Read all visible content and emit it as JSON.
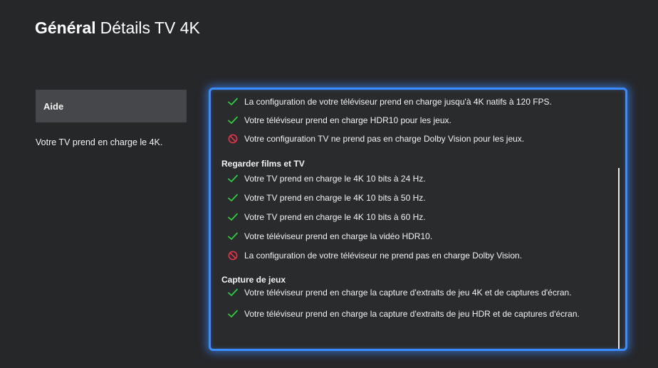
{
  "header": {
    "section": "Général",
    "subtitle": "Détails TV 4K"
  },
  "sidebar": {
    "button_label": "Aide",
    "description": "Votre TV prend en charge le 4K."
  },
  "colors": {
    "accent": "#3d8cff",
    "check": "#2ecc40",
    "unsupported": "#e8334a"
  },
  "details": {
    "rows_top": [
      {
        "status": "check",
        "text": "La configuration de votre téléviseur prend en charge jusqu'à 4K natifs à 120 FPS."
      },
      {
        "status": "check",
        "text": "Votre téléviseur prend en charge HDR10 pour les jeux."
      },
      {
        "status": "unsupported",
        "text": "Votre configuration TV ne prend pas en charge Dolby Vision pour les jeux."
      }
    ],
    "sections": [
      {
        "title": "Regarder films et TV",
        "rows": [
          {
            "status": "check",
            "text": "Votre TV prend en charge le 4K 10 bits à 24 Hz."
          },
          {
            "status": "check",
            "text": "Votre TV prend en charge le 4K 10 bits à 50 Hz."
          },
          {
            "status": "check",
            "text": "Votre TV prend en charge le 4K 10 bits à 60 Hz."
          },
          {
            "status": "check",
            "text": "Votre téléviseur prend en charge la vidéo HDR10."
          },
          {
            "status": "unsupported",
            "text": "La configuration de votre téléviseur ne prend pas en charge Dolby Vision."
          }
        ]
      },
      {
        "title": "Capture de jeux",
        "rows": [
          {
            "status": "check",
            "text": "Votre téléviseur prend en charge la capture d'extraits de jeu 4K et de captures d'écran."
          },
          {
            "status": "check",
            "text": "Votre téléviseur prend en charge la capture d'extraits de jeu HDR et de captures d'écran."
          }
        ]
      }
    ]
  }
}
